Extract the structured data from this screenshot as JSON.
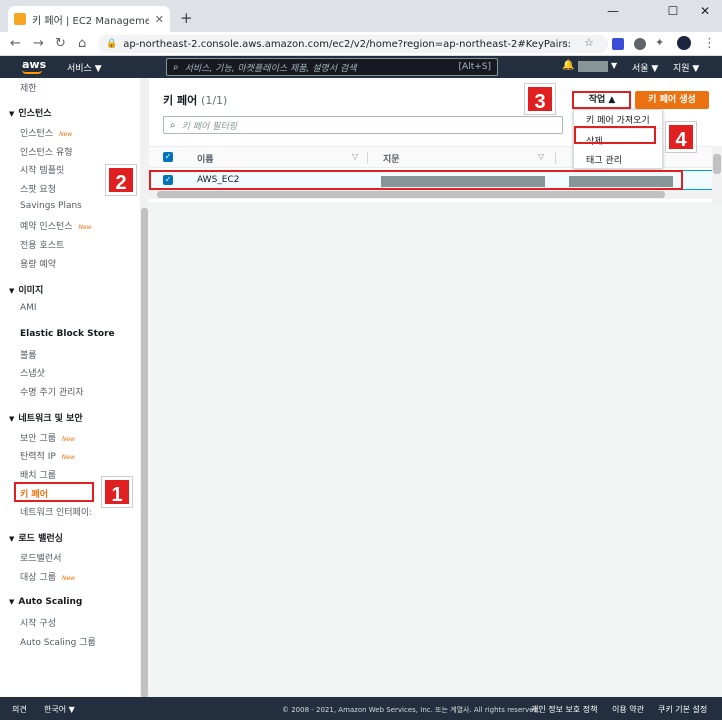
{
  "browser": {
    "tab_title": "키 페어 | EC2 Management Cor",
    "url": "ap-northeast-2.console.aws.amazon.com/ec2/v2/home?region=ap-northeast-2#KeyPairs:"
  },
  "aws_header": {
    "logo": "aws",
    "services_label": "서비스 ▼",
    "search_placeholder": "서비스, 기능, 마켓플레이스 제품, 설명서 검색",
    "search_shortcut": "[Alt+S]",
    "region_label": "서울 ▼",
    "support_label": "지원 ▼"
  },
  "sidebar": {
    "items": [
      {
        "label": "제한",
        "new": ""
      },
      {
        "label": "인스턴스",
        "new": "New"
      },
      {
        "label": "인스턴스 유형",
        "new": ""
      },
      {
        "label": "시작 템플릿",
        "new": ""
      },
      {
        "label": "스팟 요청",
        "new": ""
      },
      {
        "label": "Savings Plans",
        "new": ""
      },
      {
        "label": "예약 인스턴스",
        "new": "New"
      },
      {
        "label": "전용 호스트",
        "new": ""
      },
      {
        "label": "용량 예약",
        "new": ""
      },
      {
        "label": "AMI",
        "new": ""
      },
      {
        "label": "볼륨",
        "new": ""
      },
      {
        "label": "스냅샷",
        "new": ""
      },
      {
        "label": "수명 주기 관리자",
        "new": ""
      },
      {
        "label": "보안 그룹",
        "new": "New"
      },
      {
        "label": "탄력적 IP",
        "new": "New"
      },
      {
        "label": "배치 그룹",
        "new": ""
      },
      {
        "label": "키 페어",
        "new": ""
      },
      {
        "label": "네트워크 인터페이:",
        "new": ""
      },
      {
        "label": "로드밸런서",
        "new": ""
      },
      {
        "label": "대상 그룹",
        "new": "New"
      },
      {
        "label": "시작 구성",
        "new": ""
      },
      {
        "label": "Auto Scaling 그룹",
        "new": ""
      }
    ],
    "sections": [
      {
        "label": "인스턴스"
      },
      {
        "label": "이미지"
      },
      {
        "label": "Elastic Block Store"
      },
      {
        "label": "네트워크 및 보안"
      },
      {
        "label": "로드 밸런싱"
      },
      {
        "label": "Auto Scaling"
      }
    ]
  },
  "main": {
    "title": "키 페어",
    "count": "(1/1)",
    "filter_placeholder": "키 페어 필터링",
    "actions_label": "작업 ▲",
    "create_label": "키 페어 생성",
    "dropdown": [
      "키 페어 가져오기",
      "삭제",
      "태그 관리"
    ],
    "columns": [
      "이름",
      "지문"
    ],
    "rows": [
      {
        "name": "AWS_EC2"
      }
    ]
  },
  "footer": {
    "feedback": "의견",
    "language": "한국어 ▼",
    "copyright": "© 2008 - 2021, Amazon Web Services, Inc. 또는 계열사. All rights reserved.",
    "privacy": "개인 정보 보호 정책",
    "terms": "이용 약관",
    "cookies": "쿠키 기본 설정"
  },
  "annotations": [
    "1",
    "2",
    "3",
    "4"
  ],
  "colors": {
    "accent": "#ec7211",
    "header": "#232f3e",
    "highlight": "#e02020",
    "selected": "#0073bb"
  }
}
